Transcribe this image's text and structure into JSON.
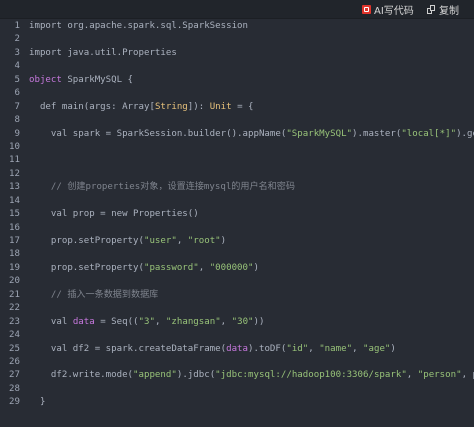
{
  "toolbar": {
    "ai_label": "AI写代码",
    "copy_label": "复制",
    "ai_icon": "ai-code-icon",
    "copy_icon": "copy-icon"
  },
  "colors": {
    "background": "#282c34",
    "keyword": "#c678dd",
    "string": "#98c379",
    "type": "#e5c07b",
    "comment": "#7f848e",
    "line_number": "#9da5b4",
    "ai_badge": "#e0342c"
  },
  "code": {
    "line_numbers": [
      "1",
      "2",
      "3",
      "4",
      "5",
      "6",
      "7",
      "8",
      "9",
      "10",
      "11",
      "12",
      "13",
      "14",
      "15",
      "16",
      "17",
      "18",
      "19",
      "20",
      "21",
      "22",
      "23",
      "24",
      "25",
      "26",
      "27",
      "28",
      "29"
    ],
    "lines": [
      [
        {
          "t": "import org.apache.spark.sql.SparkSession",
          "c": ""
        }
      ],
      [],
      [
        {
          "t": "import java.util.Properties",
          "c": ""
        }
      ],
      [],
      [
        {
          "t": "object",
          "c": "kw"
        },
        {
          "t": " SparkMySQL {",
          "c": ""
        }
      ],
      [],
      [
        {
          "t": "  def main(args: Array[",
          "c": ""
        },
        {
          "t": "String",
          "c": "ty"
        },
        {
          "t": "]): ",
          "c": ""
        },
        {
          "t": "Unit",
          "c": "ty"
        },
        {
          "t": " = {",
          "c": ""
        }
      ],
      [],
      [
        {
          "t": "    val spark = SparkSession.builder().appName(",
          "c": ""
        },
        {
          "t": "\"SparkMySQL\"",
          "c": "str"
        },
        {
          "t": ").master(",
          "c": ""
        },
        {
          "t": "\"local[*]\"",
          "c": "str"
        },
        {
          "t": ").getOr",
          "c": ""
        }
      ],
      [],
      [],
      [],
      [
        {
          "t": "    // 创建properties对象，设置连接mysql的用户名和密码",
          "c": "cm"
        }
      ],
      [],
      [
        {
          "t": "    val prop = new Properties()",
          "c": ""
        }
      ],
      [],
      [
        {
          "t": "    prop.setProperty(",
          "c": ""
        },
        {
          "t": "\"user\"",
          "c": "str"
        },
        {
          "t": ", ",
          "c": ""
        },
        {
          "t": "\"root\"",
          "c": "str"
        },
        {
          "t": ")",
          "c": ""
        }
      ],
      [],
      [
        {
          "t": "    prop.setProperty(",
          "c": ""
        },
        {
          "t": "\"password\"",
          "c": "str"
        },
        {
          "t": ", ",
          "c": ""
        },
        {
          "t": "\"000000\"",
          "c": "str"
        },
        {
          "t": ")",
          "c": ""
        }
      ],
      [],
      [
        {
          "t": "    // 插入一条数据到数据库",
          "c": "cm"
        }
      ],
      [],
      [
        {
          "t": "    val ",
          "c": ""
        },
        {
          "t": "data",
          "c": "kw"
        },
        {
          "t": " = Seq((",
          "c": ""
        },
        {
          "t": "\"3\"",
          "c": "str"
        },
        {
          "t": ", ",
          "c": ""
        },
        {
          "t": "\"zhangsan\"",
          "c": "str"
        },
        {
          "t": ", ",
          "c": ""
        },
        {
          "t": "\"30\"",
          "c": "str"
        },
        {
          "t": "))",
          "c": ""
        }
      ],
      [],
      [
        {
          "t": "    val df2 = spark.createDataFrame(",
          "c": ""
        },
        {
          "t": "data",
          "c": "kw"
        },
        {
          "t": ").toDF(",
          "c": ""
        },
        {
          "t": "\"id\"",
          "c": "str"
        },
        {
          "t": ", ",
          "c": ""
        },
        {
          "t": "\"name\"",
          "c": "str"
        },
        {
          "t": ", ",
          "c": ""
        },
        {
          "t": "\"age\"",
          "c": "str"
        },
        {
          "t": ")",
          "c": ""
        }
      ],
      [],
      [
        {
          "t": "    df2.write.mode(",
          "c": ""
        },
        {
          "t": "\"append\"",
          "c": "str"
        },
        {
          "t": ").jdbc(",
          "c": ""
        },
        {
          "t": "\"jdbc:mysql://hadoop100:3306/spark\"",
          "c": "str"
        },
        {
          "t": ", ",
          "c": ""
        },
        {
          "t": "\"person\"",
          "c": "str"
        },
        {
          "t": ", prop",
          "c": ""
        }
      ],
      [],
      [
        {
          "t": "  }",
          "c": ""
        }
      ]
    ]
  }
}
